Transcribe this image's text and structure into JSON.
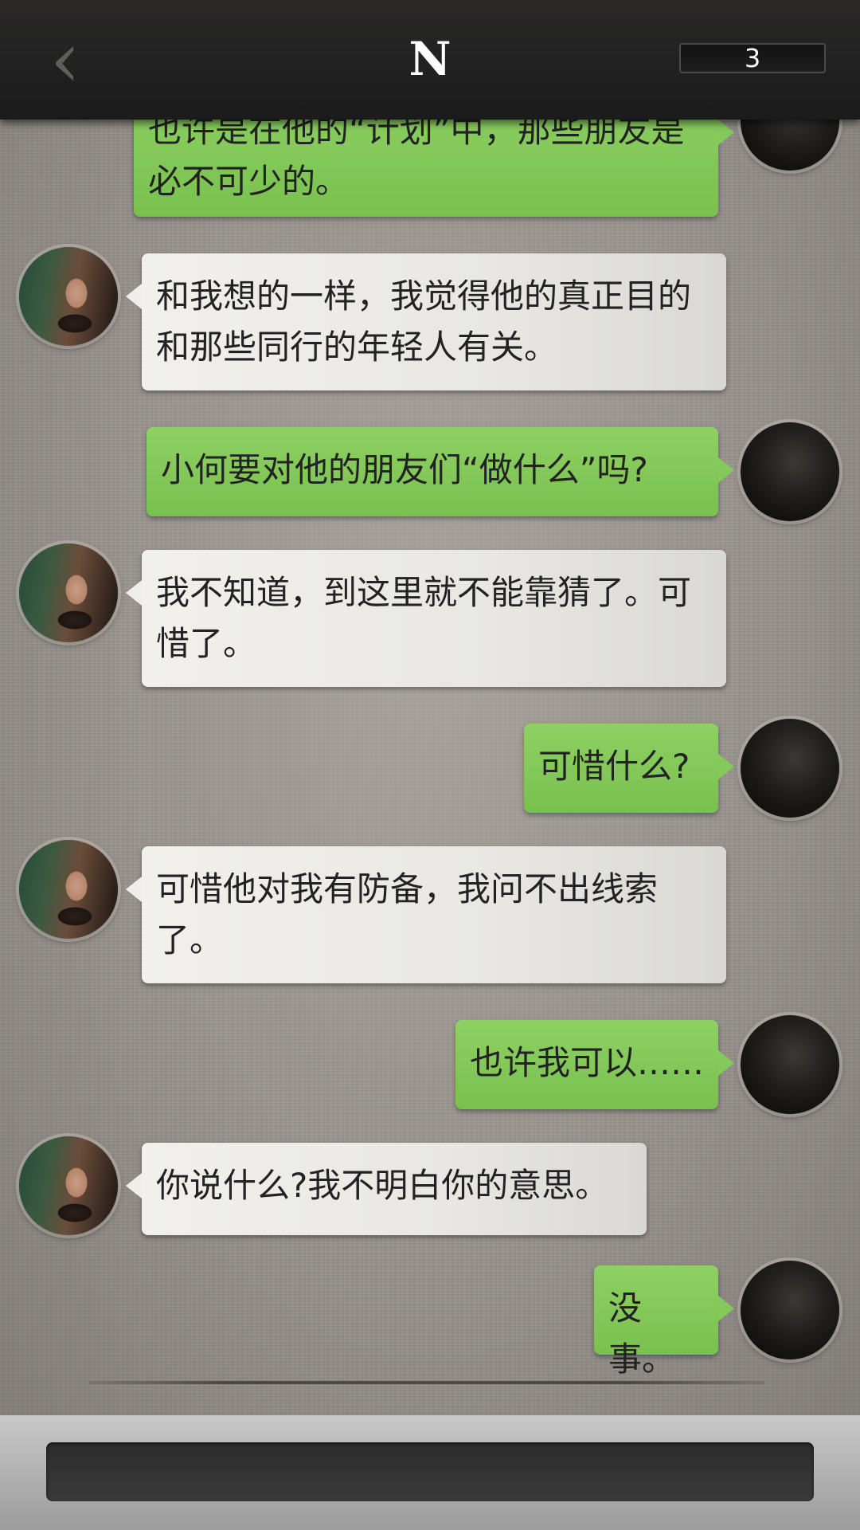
{
  "header": {
    "back_icon": "chevron-left-icon",
    "title": "N",
    "counter": "3"
  },
  "messages": [
    {
      "from": "me",
      "text": "也许是在他的“计划”中，那些朋友是必不可少的。"
    },
    {
      "from": "other",
      "text": "和我想的一样，我觉得他的真正目的和那些同行的年轻人有关。"
    },
    {
      "from": "me",
      "text": "小何要对他的朋友们“做什么”吗?"
    },
    {
      "from": "other",
      "text": "我不知道，到这里就不能靠猜了。可惜了。"
    },
    {
      "from": "me",
      "text": "可惜什么?"
    },
    {
      "from": "other",
      "text": "可惜他对我有防备，我问不出线索了。"
    },
    {
      "from": "me",
      "text": "也许我可以……"
    },
    {
      "from": "other",
      "text": "你说什么?我不明白你的意思。"
    },
    {
      "from": "me",
      "text": "没事。"
    }
  ],
  "colors": {
    "outgoing_bubble": "#7dc453",
    "incoming_bubble": "#eceae6",
    "header_bg": "#1f1f1f"
  }
}
